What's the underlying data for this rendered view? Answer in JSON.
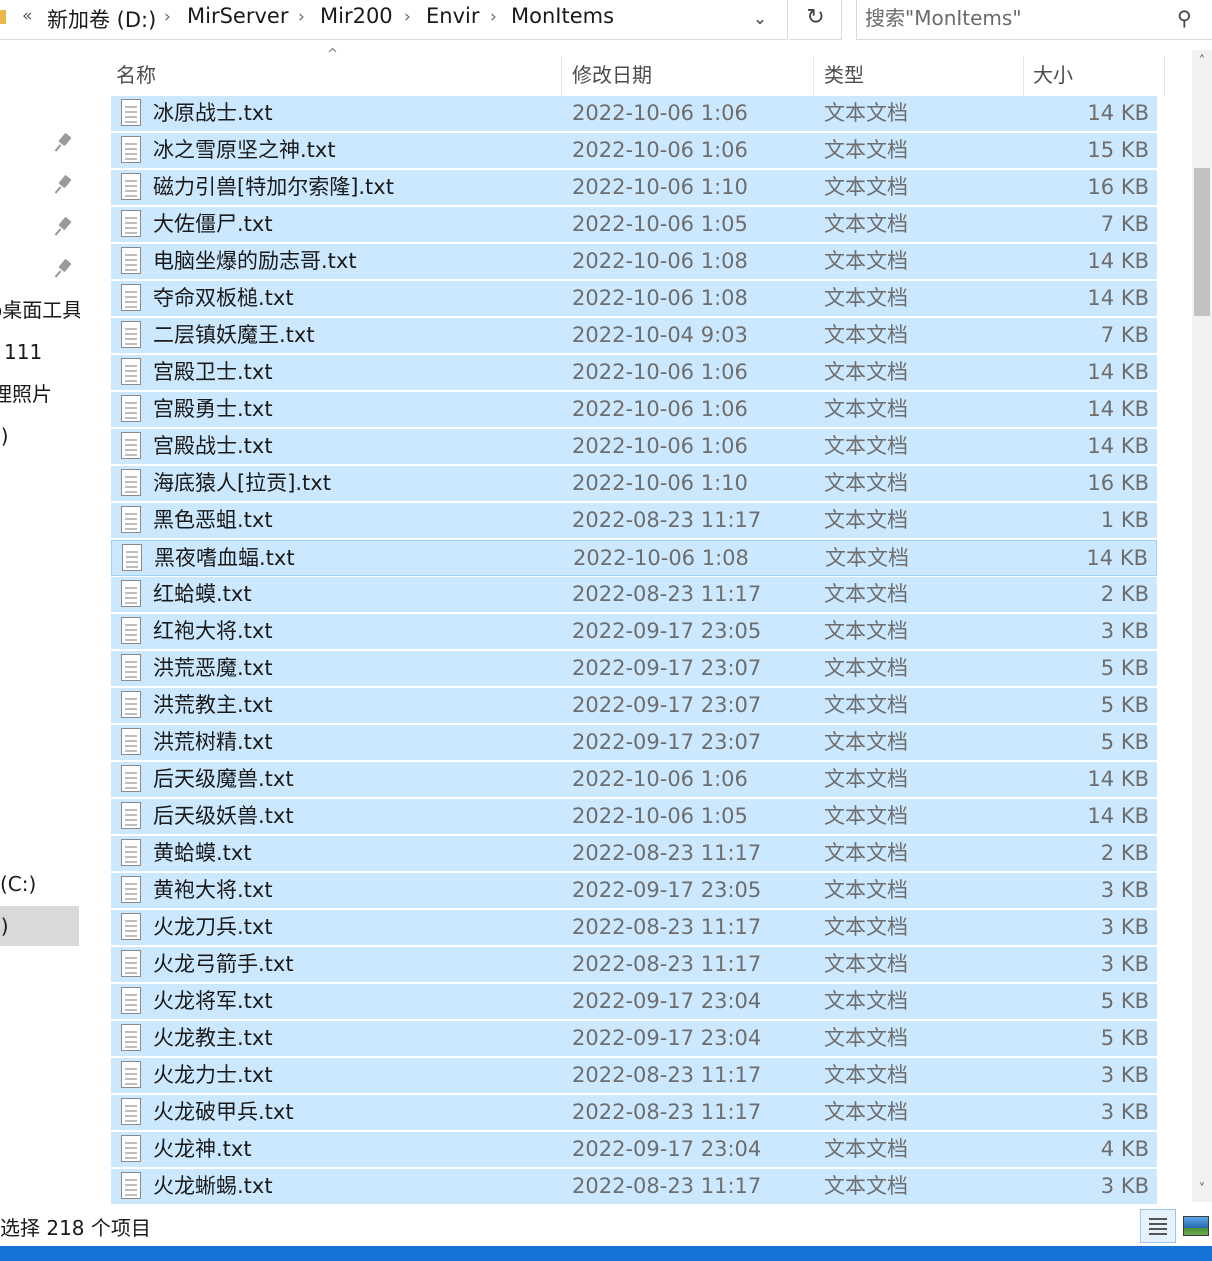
{
  "address": {
    "overflow": "«",
    "breadcrumbs": [
      "新加卷 (D:)",
      "MirServer",
      "Mir200",
      "Envir",
      "MonItems"
    ],
    "separator": "›",
    "dropdown": "⌄",
    "refresh": "↻"
  },
  "search": {
    "placeholder": "搜索\"MonItems\"",
    "icon": "search-icon",
    "glyph": "⚲"
  },
  "nav": {
    "items": [
      "o桌面工具",
      "111",
      "理照片",
      ":)",
      "(C:)",
      ":)"
    ]
  },
  "columns": {
    "name": "名称",
    "modified": "修改日期",
    "type": "类型",
    "size": "大小",
    "sort_glyph": "^"
  },
  "files": [
    {
      "name": "冰原战士.txt",
      "modified": "2022-10-06 1:06",
      "type": "文本文档",
      "size": "14 KB"
    },
    {
      "name": "冰之雪原坚之神.txt",
      "modified": "2022-10-06 1:06",
      "type": "文本文档",
      "size": "15 KB"
    },
    {
      "name": "磁力引兽[特加尔索隆].txt",
      "modified": "2022-10-06 1:10",
      "type": "文本文档",
      "size": "16 KB"
    },
    {
      "name": "大佐僵尸.txt",
      "modified": "2022-10-06 1:05",
      "type": "文本文档",
      "size": "7 KB"
    },
    {
      "name": "电脑坐爆的励志哥.txt",
      "modified": "2022-10-06 1:08",
      "type": "文本文档",
      "size": "14 KB"
    },
    {
      "name": "夺命双板槌.txt",
      "modified": "2022-10-06 1:08",
      "type": "文本文档",
      "size": "14 KB"
    },
    {
      "name": "二层镇妖魔王.txt",
      "modified": "2022-10-04 9:03",
      "type": "文本文档",
      "size": "7 KB"
    },
    {
      "name": "宫殿卫士.txt",
      "modified": "2022-10-06 1:06",
      "type": "文本文档",
      "size": "14 KB"
    },
    {
      "name": "宫殿勇士.txt",
      "modified": "2022-10-06 1:06",
      "type": "文本文档",
      "size": "14 KB"
    },
    {
      "name": "宫殿战士.txt",
      "modified": "2022-10-06 1:06",
      "type": "文本文档",
      "size": "14 KB"
    },
    {
      "name": "海底猿人[拉贡].txt",
      "modified": "2022-10-06 1:10",
      "type": "文本文档",
      "size": "16 KB"
    },
    {
      "name": "黑色恶蛆.txt",
      "modified": "2022-08-23 11:17",
      "type": "文本文档",
      "size": "1 KB"
    },
    {
      "name": "黑夜嗜血蝠.txt",
      "modified": "2022-10-06 1:08",
      "type": "文本文档",
      "size": "14 KB"
    },
    {
      "name": "红蛤蟆.txt",
      "modified": "2022-08-23 11:17",
      "type": "文本文档",
      "size": "2 KB"
    },
    {
      "name": "红袍大将.txt",
      "modified": "2022-09-17 23:05",
      "type": "文本文档",
      "size": "3 KB"
    },
    {
      "name": "洪荒恶魔.txt",
      "modified": "2022-09-17 23:07",
      "type": "文本文档",
      "size": "5 KB"
    },
    {
      "name": "洪荒教主.txt",
      "modified": "2022-09-17 23:07",
      "type": "文本文档",
      "size": "5 KB"
    },
    {
      "name": "洪荒树精.txt",
      "modified": "2022-09-17 23:07",
      "type": "文本文档",
      "size": "5 KB"
    },
    {
      "name": "后天级魔兽.txt",
      "modified": "2022-10-06 1:06",
      "type": "文本文档",
      "size": "14 KB"
    },
    {
      "name": "后天级妖兽.txt",
      "modified": "2022-10-06 1:05",
      "type": "文本文档",
      "size": "14 KB"
    },
    {
      "name": "黄蛤蟆.txt",
      "modified": "2022-08-23 11:17",
      "type": "文本文档",
      "size": "2 KB"
    },
    {
      "name": "黄袍大将.txt",
      "modified": "2022-09-17 23:05",
      "type": "文本文档",
      "size": "3 KB"
    },
    {
      "name": "火龙刀兵.txt",
      "modified": "2022-08-23 11:17",
      "type": "文本文档",
      "size": "3 KB"
    },
    {
      "name": "火龙弓箭手.txt",
      "modified": "2022-08-23 11:17",
      "type": "文本文档",
      "size": "3 KB"
    },
    {
      "name": "火龙将军.txt",
      "modified": "2022-09-17 23:04",
      "type": "文本文档",
      "size": "5 KB"
    },
    {
      "name": "火龙教主.txt",
      "modified": "2022-09-17 23:04",
      "type": "文本文档",
      "size": "5 KB"
    },
    {
      "name": "火龙力士.txt",
      "modified": "2022-08-23 11:17",
      "type": "文本文档",
      "size": "3 KB"
    },
    {
      "name": "火龙破甲兵.txt",
      "modified": "2022-08-23 11:17",
      "type": "文本文档",
      "size": "3 KB"
    },
    {
      "name": "火龙神.txt",
      "modified": "2022-09-17 23:04",
      "type": "文本文档",
      "size": "4 KB"
    },
    {
      "name": "火龙蜥蜴.txt",
      "modified": "2022-08-23 11:17",
      "type": "文本文档",
      "size": "3 KB"
    }
  ],
  "focused_row": 12,
  "status": {
    "text": "选择 218 个项目"
  },
  "scrollbar": {
    "up": "˄",
    "down": "˅"
  },
  "colors": {
    "selection": "#cce8ff",
    "focus_border": "#99d1ff",
    "taskbar": "#1573d8"
  }
}
